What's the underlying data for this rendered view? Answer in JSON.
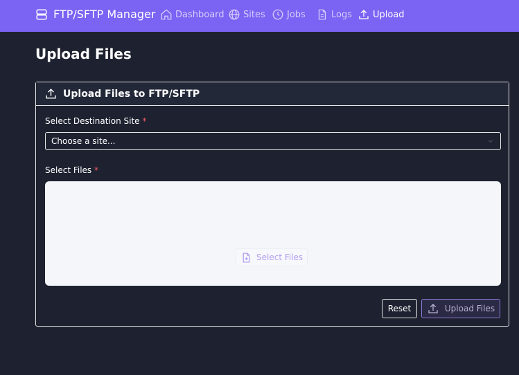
{
  "navbar": {
    "brand": "FTP/SFTP Manager",
    "items": [
      {
        "label": "Dashboard",
        "icon": "home-icon"
      },
      {
        "label": "Sites",
        "icon": "globe-icon"
      },
      {
        "label": "Jobs",
        "icon": "clock-icon"
      },
      {
        "label": "Logs",
        "icon": "document-icon"
      },
      {
        "label": "Upload",
        "icon": "upload-icon",
        "active": true
      }
    ]
  },
  "page": {
    "title": "Upload Files"
  },
  "card": {
    "title": "Upload Files to FTP/SFTP",
    "destination_label": "Select Destination Site",
    "required_mark": "*",
    "destination_value": "Choose a site...",
    "files_label": "Select Files",
    "select_files_button": "Select Files",
    "reset_button": "Reset",
    "upload_button": "Upload Files"
  },
  "colors": {
    "navbar": "#7b63f3",
    "background": "#1e2230",
    "dropzone": "#f4f6fa",
    "required": "#ff5a6a"
  }
}
